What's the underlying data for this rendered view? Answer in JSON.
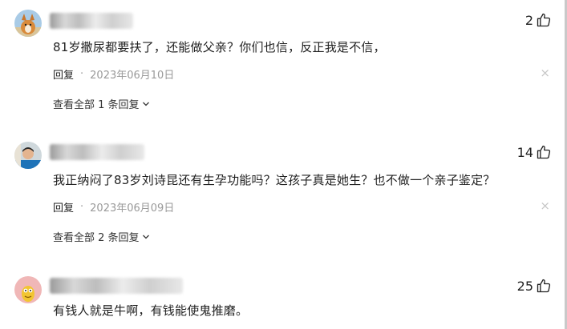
{
  "colors": {
    "text": "#222222",
    "muted": "#999999",
    "close": "#c6c6c6"
  },
  "comments": [
    {
      "avatar": "corgi-avatar",
      "likes": "2",
      "text": "81岁撒尿都要扶了，还能做父亲？你们也信，反正我是不信，",
      "reply_label": "回复",
      "separator": "·",
      "date": "2023年06月10日",
      "close": "×",
      "view_replies": "查看全部 1 条回复"
    },
    {
      "avatar": "man-avatar",
      "likes": "14",
      "text": "我正纳闷了83岁刘诗昆还有生孕功能吗？这孩子真是她生？也不做一个亲子鉴定？",
      "reply_label": "回复",
      "separator": "·",
      "date": "2023年06月09日",
      "close": "×",
      "view_replies": "查看全部 2 条回复"
    },
    {
      "avatar": "cartoon-avatar",
      "likes": "25",
      "text": "有钱人就是牛啊，有钱能使鬼推磨。"
    }
  ]
}
